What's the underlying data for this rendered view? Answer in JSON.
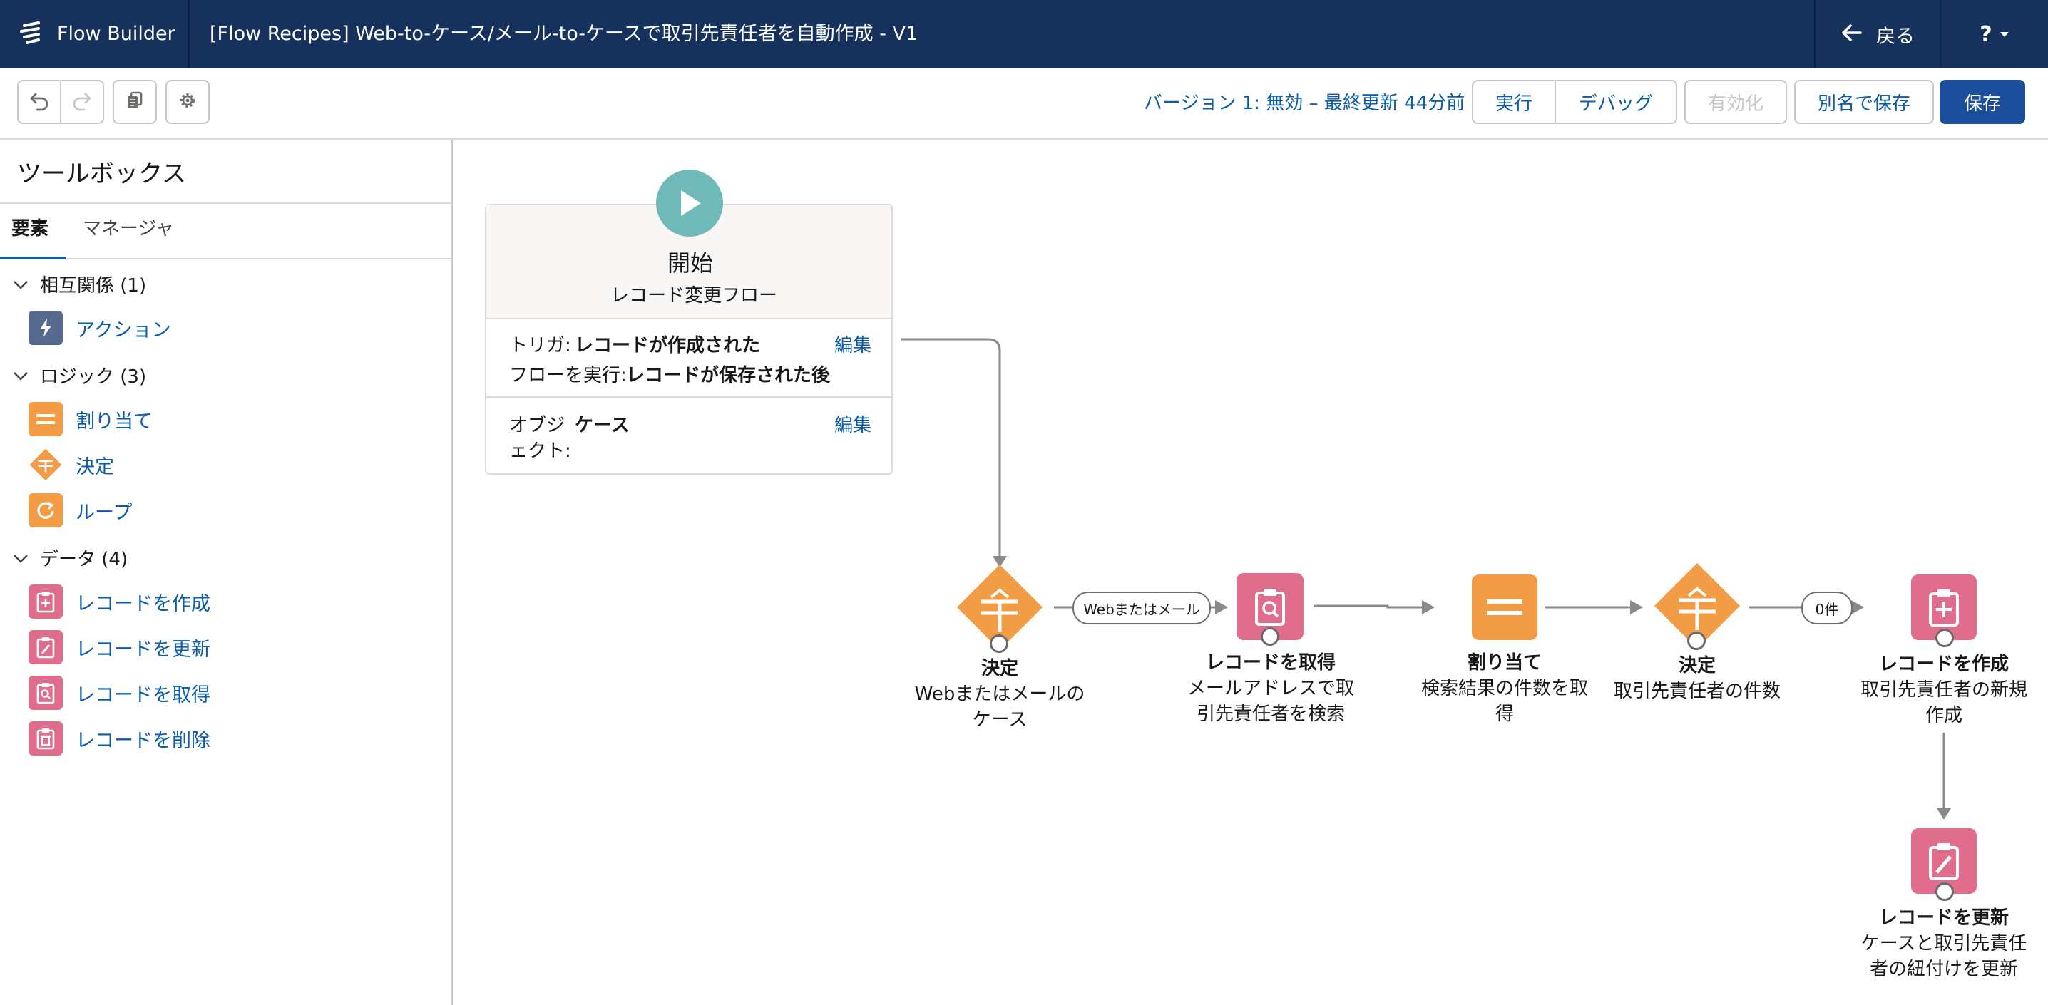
{
  "header": {
    "app_name": "Flow Builder",
    "flow_title": "[Flow Recipes] Web-to-ケース/メール-to-ケースで取引先責任者を自動作成 - V1",
    "back_label": "戻る",
    "help_label": "?"
  },
  "toolbar": {
    "version_status": "バージョン 1: 無効 – 最終更新 44分前",
    "run_label": "実行",
    "debug_label": "デバッグ",
    "activate_label": "有効化",
    "save_as_label": "別名で保存",
    "save_label": "保存"
  },
  "sidebar": {
    "title": "ツールボックス",
    "tabs": [
      {
        "label": "要素"
      },
      {
        "label": "マネージャ"
      }
    ],
    "sections": [
      {
        "label": "相互関係 (1)",
        "items": [
          {
            "label": "アクション",
            "icon": "lightning-icon"
          }
        ]
      },
      {
        "label": "ロジック (3)",
        "items": [
          {
            "label": "割り当て",
            "icon": "assignment-icon"
          },
          {
            "label": "決定",
            "icon": "decision-icon"
          },
          {
            "label": "ループ",
            "icon": "loop-icon"
          }
        ]
      },
      {
        "label": "データ (4)",
        "items": [
          {
            "label": "レコードを作成",
            "icon": "record-create-icon"
          },
          {
            "label": "レコードを更新",
            "icon": "record-update-icon"
          },
          {
            "label": "レコードを取得",
            "icon": "record-lookup-icon"
          },
          {
            "label": "レコードを削除",
            "icon": "record-delete-icon"
          }
        ]
      }
    ]
  },
  "start": {
    "title": "開始",
    "subtitle": "レコード変更フロー",
    "trigger_label": "トリガ:",
    "trigger_value": "レコードが作成された",
    "run_label": "フローを実行:",
    "run_value": "レコードが保存された後",
    "object_label_1": "オブジ",
    "object_label_2": "ェクト:",
    "object_value": "ケース",
    "edit_label": "編集"
  },
  "nodes": {
    "decision1": {
      "type": "決定",
      "label_1": "Webまたはメールの",
      "label_2": "ケース"
    },
    "lookup": {
      "type": "レコードを取得",
      "label_1": "メールアドレスで取",
      "label_2": "引先責任者を検索"
    },
    "assign": {
      "type": "割り当て",
      "label_1": "検索結果の件数を取",
      "label_2": "得"
    },
    "decision2": {
      "type": "決定",
      "label_1": "取引先責任者の件数"
    },
    "create": {
      "type": "レコードを作成",
      "label_1": "取引先責任者の新規",
      "label_2": "作成"
    },
    "update": {
      "type": "レコードを更新",
      "label_1": "ケースと取引先責任",
      "label_2": "者の紐付けを更新"
    }
  },
  "connectors": {
    "outcome1": "Webまたはメール",
    "outcome2": "0件"
  },
  "colors": {
    "header_bg": "#16325c",
    "decision": "#f29d45",
    "assignment": "#f29d45",
    "record": "#e06d8c",
    "start": "#6fb9b8",
    "link": "#0b5cab",
    "primary": "#1b4f9c"
  }
}
